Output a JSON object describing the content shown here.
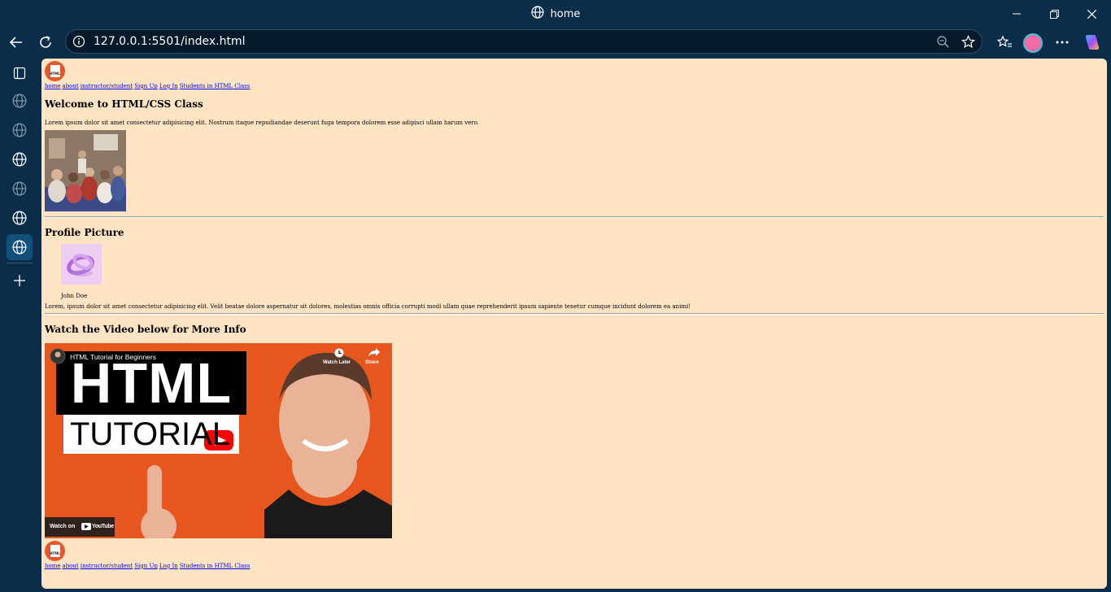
{
  "window": {
    "title": "home"
  },
  "browser": {
    "url": "127.0.0.1:5501/index.html",
    "active_tab_index": 6
  },
  "page": {
    "nav_links": [
      "home",
      "about",
      "instructor/student",
      "Sign Up",
      "Log In",
      "Students in HTML Class"
    ],
    "logo_text": "HTML",
    "welcome_heading": "Welcome to HTML/CSS Class",
    "welcome_paragraph": "Lorem ipsum dolor sit amet consectetur adipisicing elit. Nostrum itaque repudiandae deserunt fuga tempora dolorem esse adipisci ullam harum vero.",
    "profile_heading": "Profile Picture",
    "profile_caption": "John Doe",
    "profile_paragraph": "Lorem, ipsum dolor sit amet consectetur adipisicing elit. Velit beatae dolore aspernatur sit dolores, molestias omnis officia corrupti modi ullam quae reprehenderit ipsum sapiente tenetur cumque incidunt dolorem ea animi!",
    "video_heading": "Watch the Video below for More Info",
    "video": {
      "title": "HTML Tutorial for Beginners",
      "watch_later": "Watch Later",
      "share": "Share",
      "watch_on": "Watch on",
      "youtube": "YouTube",
      "thumb_word1": "HTML",
      "thumb_word2": "TUTORIAL"
    }
  }
}
